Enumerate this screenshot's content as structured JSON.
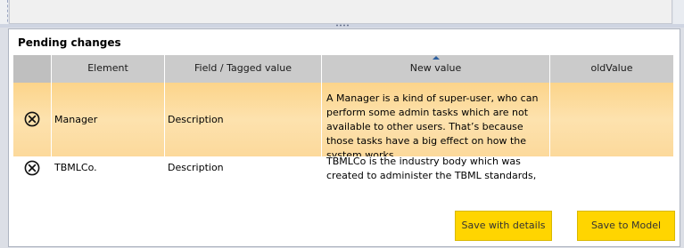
{
  "panel": {
    "title": "Pending changes"
  },
  "table": {
    "columns": [
      "Element",
      "Field / Tagged value",
      "New value",
      "oldValue"
    ],
    "sorted_column": "New value",
    "rows": [
      {
        "element": "Manager",
        "field": "Description",
        "new_value": "A Manager is a kind of super-user, who can perform some admin tasks which are not available to other users. That’s because those tasks have a big effect on how the system works",
        "old_value": "",
        "selected": true
      },
      {
        "element": "TBMLCo.",
        "field": "Description",
        "new_value": "TBMLCo is the industry body which was created to administer the TBML standards, and manage t…",
        "old_value": "",
        "selected": false
      }
    ]
  },
  "buttons": {
    "save_with_details": "Save with details",
    "save_to_model": "Save to Model"
  },
  "colors": {
    "selected_row": "#fcd48a",
    "button": "#ffd500",
    "header": "#cbcbcb",
    "sort_arrow": "#2d5f9e"
  },
  "icons": {
    "row_action": "delete-circle-x-icon"
  }
}
